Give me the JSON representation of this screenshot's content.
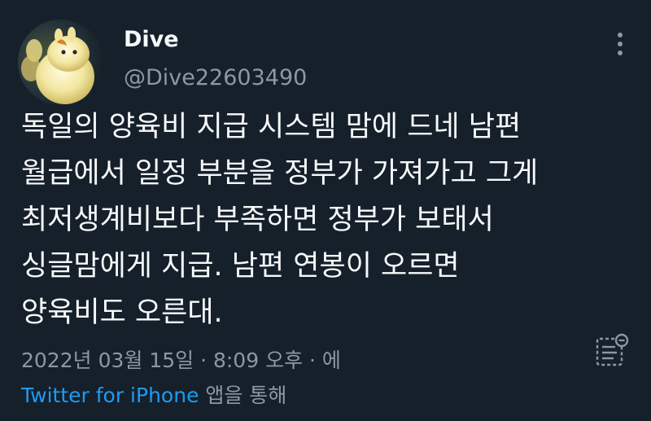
{
  "author": {
    "display_name": "Dive",
    "handle": "@Dive22603490",
    "avatar_icon": "moomin-avatar"
  },
  "tweet": {
    "lines": [
      "독일의 양육비 지급 시스템 맘에 드네 남편",
      "월급에서 일정 부분을 정부가 가져가고 그게",
      "최저생계비보다 부족하면 정부가 보태서",
      "싱글맘에게 지급. 남편 연봉이 오르면",
      "양육비도 오른대."
    ]
  },
  "meta": {
    "timestamp": "2022년 03월 15일 · 8:09 오후 · 에",
    "source_app": "Twitter for iPhone",
    "source_suffix": "앱을 통해"
  },
  "icons": {
    "more": "more-vertical-icon",
    "translate": "translate-icon"
  },
  "colors": {
    "background": "#15202b",
    "text_primary": "#f7f9f9",
    "text_secondary": "#8b98a5",
    "link": "#1d9bf0"
  }
}
